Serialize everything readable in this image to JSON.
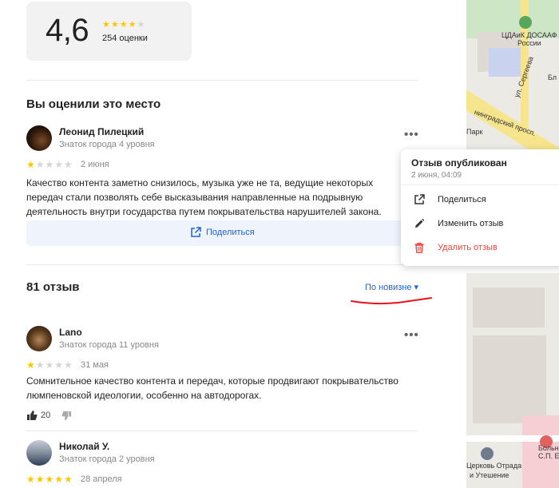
{
  "summary": {
    "rating": "4,6",
    "stars": "★★★★",
    "stars_half": "★",
    "count_label": "254 оценки"
  },
  "my_review": {
    "heading": "Вы оценили это место",
    "author": "Леонид Пилецкий",
    "level": "Знаток города 4 уровня",
    "stars_on": "★",
    "stars_off": "★★★★",
    "date": "2 июня",
    "text": "Качество контента заметно снизилось, музыка уже не та, ведущие некоторых передач стали позволять себе высказывания направленные на подрывную деятельность внутри государства путем покрывательства нарушителей закона.",
    "share_label": "Поделиться"
  },
  "reviews_header": {
    "count": "81 отзыв",
    "sort_label": "По новизне ▾"
  },
  "reviews": [
    {
      "author": "Lano",
      "level": "Знаток города 11 уровня",
      "stars_on": "★",
      "stars_off": "★★★★",
      "date": "31 мая",
      "text": "Сомнительное качество контента и передач, которые продвигают покрывательство люмпеновской идеологии, особенно на автодорогах.",
      "likes": "20"
    },
    {
      "author": "Николай У.",
      "level": "Знаток города 2 уровня",
      "stars_on": "★★★★★",
      "stars_off": "",
      "date": "28 апреля"
    }
  ],
  "popup": {
    "title": "Отзыв опубликован",
    "subtitle": "2 июня, 04:09",
    "items": [
      "Поделиться",
      "Изменить отзыв",
      "Удалить отзыв"
    ]
  },
  "map": {
    "labels": [
      "ЦДАиК ДОСААФ",
      "России",
      "ул. Сергеева",
      "нинградский просп.",
      "Бл",
      "Парк",
      "Больн",
      "С.П. Е",
      "Церковь Отрада",
      "и Утешение"
    ]
  },
  "colors": {
    "star": "#ffc600",
    "link": "#1e63d9",
    "danger": "#f0443a",
    "annotation": "#e8121b"
  }
}
